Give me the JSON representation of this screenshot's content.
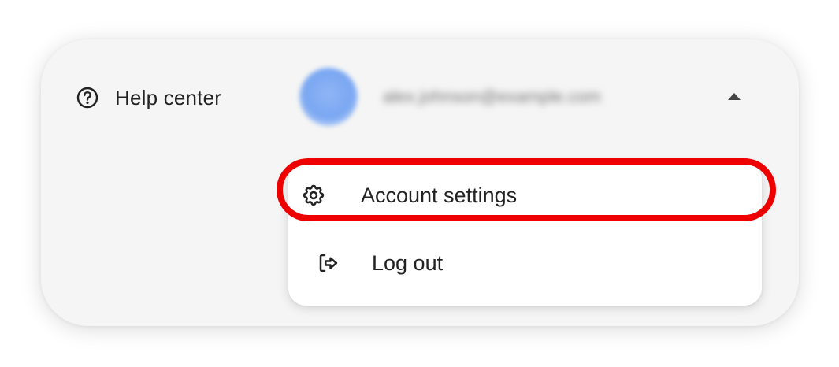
{
  "help": {
    "icon": "help-circle-icon",
    "label": "Help center"
  },
  "account": {
    "avatar_icon": "user-avatar",
    "email": "alex.johnson@example.com",
    "caret_icon": "caret-up-icon"
  },
  "menu": {
    "items": [
      {
        "icon": "gear-icon",
        "label": "Account settings"
      },
      {
        "icon": "logout-icon",
        "label": "Log out"
      }
    ]
  },
  "colors": {
    "highlight": "#ee0000",
    "card_background": "#f5f5f5",
    "avatar": "#7aa7f2"
  }
}
